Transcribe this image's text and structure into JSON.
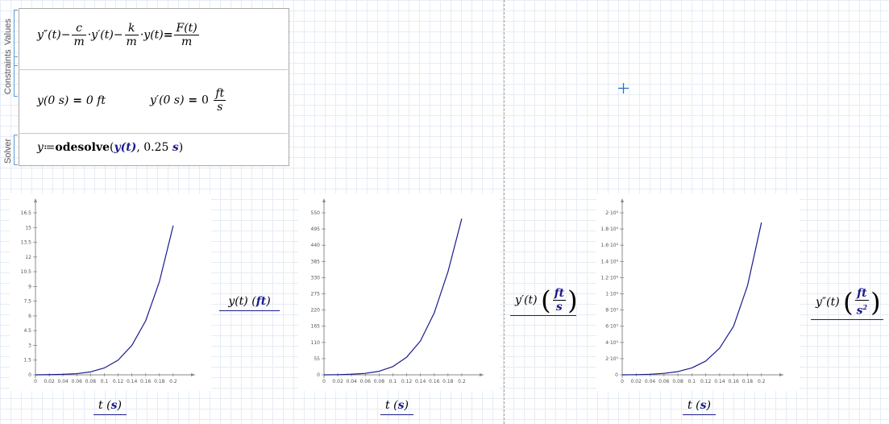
{
  "regions": {
    "values_label": "Values",
    "constraints_label": "Constraints",
    "solver_label": "Solver"
  },
  "equation": {
    "lhs_a": "y″(t)",
    "c": "c",
    "m": "m",
    "yp": "y′(t)",
    "k": "k",
    "y": "y(t)",
    "eq": "=",
    "F": "F(t)"
  },
  "initial_conditions": {
    "y0": "y(0 s)",
    "y0_val": "0 ft",
    "yp0": "y′(0 s)",
    "yp0_val": "0",
    "ft": "ft",
    "s": "s"
  },
  "solver": {
    "lhs": "y",
    "assign": "≔",
    "fn": "odesolve",
    "arg1": "y(t)",
    "arg2": "0.25",
    "arg2_unit": "s"
  },
  "plots": [
    {
      "name": "position",
      "xlabel": "t",
      "xunit": "s",
      "ylabel": "y(t)",
      "yunit": "ft",
      "x_ticks": [
        "0",
        "0.02",
        "0.04",
        "0.06",
        "0.08",
        "0.1",
        "0.12",
        "0.14",
        "0.16",
        "0.18",
        "0.2"
      ],
      "y_ticks": [
        "0",
        "1.5",
        "3",
        "4.5",
        "6",
        "7.5",
        "9",
        "10.5",
        "12",
        "13.5",
        "15",
        "16.5"
      ],
      "chart_data": {
        "type": "line",
        "xlim": [
          0,
          0.22
        ],
        "ylim": [
          0,
          16.5
        ],
        "x": [
          0,
          0.02,
          0.04,
          0.06,
          0.08,
          0.1,
          0.12,
          0.14,
          0.16,
          0.18,
          0.2
        ],
        "y": [
          0,
          0.02,
          0.05,
          0.12,
          0.3,
          0.7,
          1.5,
          3.0,
          5.5,
          9.5,
          15.2
        ]
      }
    },
    {
      "name": "velocity",
      "xlabel": "t",
      "xunit": "s",
      "ylabel": "y′(t)",
      "yunit_num": "ft",
      "yunit_den": "s",
      "x_ticks": [
        "0",
        "0.02",
        "0.04",
        "0.06",
        "0.08",
        "0.1",
        "0.12",
        "0.14",
        "0.16",
        "0.18",
        "0.2"
      ],
      "y_ticks": [
        "0",
        "55",
        "110",
        "165",
        "220",
        "275",
        "330",
        "385",
        "440",
        "495",
        "550"
      ],
      "chart_data": {
        "type": "line",
        "xlim": [
          0,
          0.22
        ],
        "ylim": [
          0,
          550
        ],
        "x": [
          0,
          0.02,
          0.04,
          0.06,
          0.08,
          0.1,
          0.12,
          0.14,
          0.16,
          0.18,
          0.2
        ],
        "y": [
          0,
          0.5,
          2,
          5,
          12,
          28,
          60,
          115,
          210,
          350,
          530
        ]
      }
    },
    {
      "name": "acceleration",
      "xlabel": "t",
      "xunit": "s",
      "ylabel": "y″(t)",
      "yunit_num": "ft",
      "yunit_den": "s",
      "yunit_exp": "2",
      "x_ticks": [
        "0",
        "0.02",
        "0.04",
        "0.06",
        "0.08",
        "0.1",
        "0.12",
        "0.14",
        "0.16",
        "0.18",
        "0.2"
      ],
      "y_ticks": [
        "0",
        "2·10⁵",
        "4·10⁵",
        "6·10⁵",
        "8·10⁵",
        "1·10⁶",
        "1.2·10⁶",
        "1.4·10⁶",
        "1.6·10⁶",
        "1.8·10⁶",
        "2·10⁶"
      ],
      "chart_data": {
        "type": "line",
        "xlim": [
          0,
          0.22
        ],
        "ylim": [
          0,
          2000000
        ],
        "x": [
          0,
          0.02,
          0.04,
          0.06,
          0.08,
          0.1,
          0.12,
          0.14,
          0.16,
          0.18,
          0.2
        ],
        "y": [
          0,
          2000,
          7000,
          18000,
          40000,
          85000,
          170000,
          330000,
          600000,
          1100000,
          1880000
        ]
      }
    }
  ]
}
